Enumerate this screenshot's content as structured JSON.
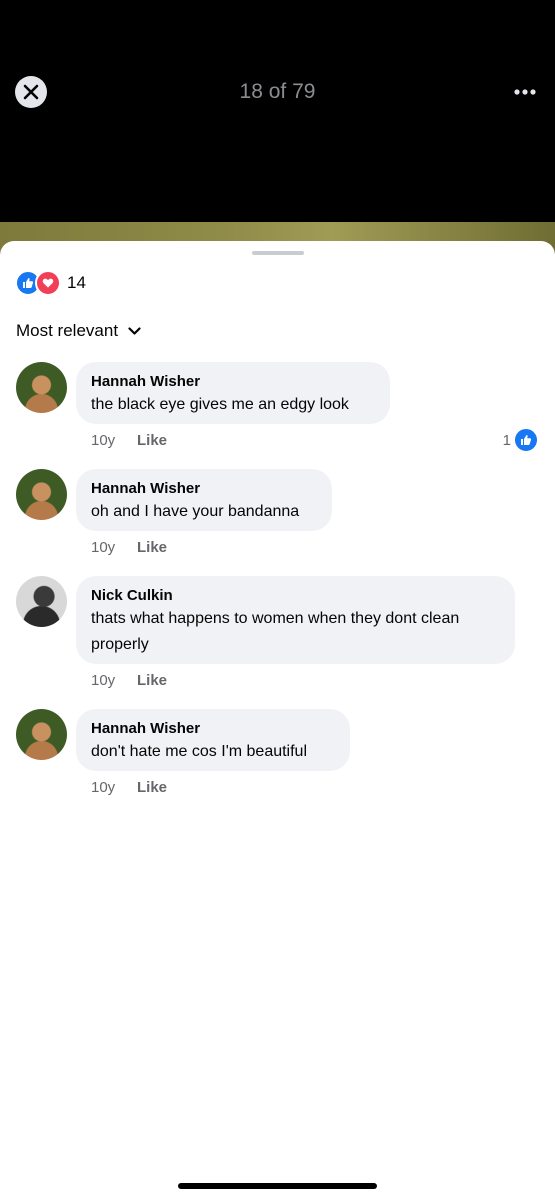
{
  "viewer": {
    "counter": "18 of 79"
  },
  "reactions": {
    "count": "14",
    "icons": [
      "like-icon",
      "love-icon"
    ]
  },
  "sort": {
    "label": "Most relevant"
  },
  "comments": [
    {
      "author": "Hannah Wisher",
      "text": "the black eye gives me an edgy look",
      "time": "10y",
      "like_label": "Like",
      "likes": "1"
    },
    {
      "author": "Hannah Wisher",
      "text": "oh and I have your bandanna",
      "time": "10y",
      "like_label": "Like"
    },
    {
      "author": "Nick Culkin",
      "text": "thats what happens to women when they dont clean properly",
      "time": "10y",
      "like_label": "Like"
    },
    {
      "author": "Hannah Wisher",
      "text": "don't hate me cos I'm beautiful",
      "time": "10y",
      "like_label": "Like"
    }
  ],
  "colors": {
    "accent": "#1877f2",
    "love": "#f33e58",
    "bubble": "#f0f2f5"
  }
}
